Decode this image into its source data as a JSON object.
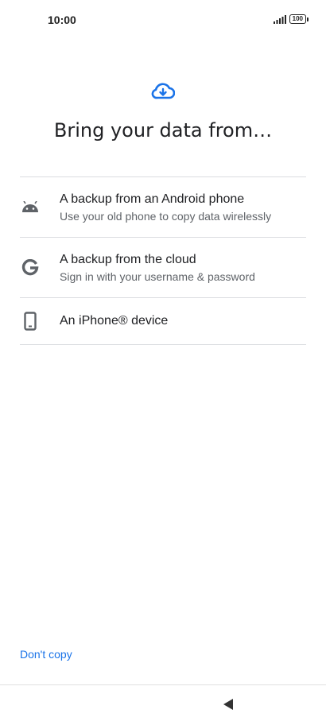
{
  "status": {
    "time": "10:00",
    "battery": "100"
  },
  "header": {
    "title": "Bring your data from…",
    "icon": "cloud-download-icon",
    "accent": "#1a73e8"
  },
  "options": [
    {
      "icon": "android-icon",
      "title": "A backup from an Android phone",
      "subtitle": "Use your old phone to copy data wirelessly"
    },
    {
      "icon": "google-icon",
      "title": "A backup from the cloud",
      "subtitle": "Sign in with your username & password"
    },
    {
      "icon": "phone-icon",
      "title": "An iPhone® device"
    }
  ],
  "footer": {
    "dont_copy": "Don't copy"
  }
}
